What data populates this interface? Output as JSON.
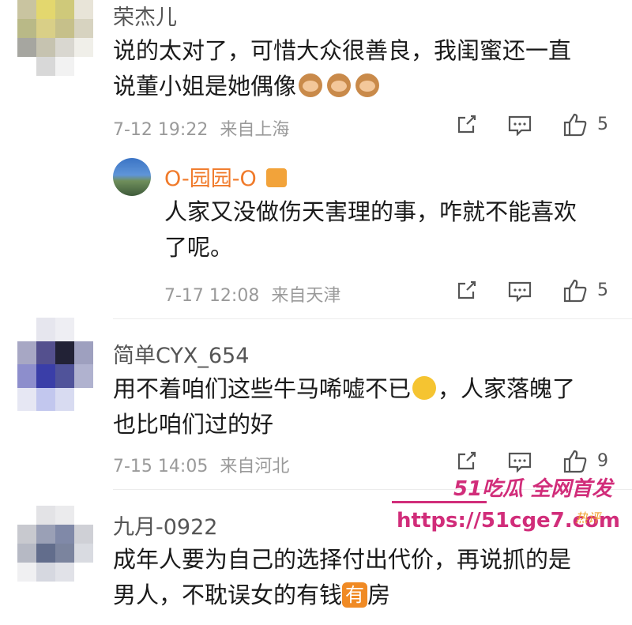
{
  "comments": [
    {
      "username": "荣杰儿",
      "text_lines": [
        "说的太对了，可惜大众很善良，我闺蜜还一直",
        "说董小姐是她偶像"
      ],
      "emoji": [
        "monkey-see-no-evil-icon",
        "monkey-see-no-evil-icon",
        "monkey-see-no-evil-icon"
      ],
      "timestamp": "7-12 19:22",
      "location": "来自上海",
      "likes": "5",
      "reply": {
        "username": "O-园园-O",
        "username_color": "#f07a2a",
        "text_lines": [
          "人家又没做伤天害理的事，咋就不能喜欢",
          "了呢。"
        ],
        "timestamp": "7-17 12:08",
        "location": "来自天津",
        "likes": "5"
      }
    },
    {
      "username": "简单CYX_654",
      "text_lines_1": "用不着咱们这些牛马唏嘘不已",
      "text_lines_1b": "，人家落魄了",
      "text_lines_2": "也比咱们过的好",
      "timestamp": "7-15 14:05",
      "location": "来自河北",
      "likes": "9"
    },
    {
      "username": "九月-0922",
      "text_lines_1": "成年人要为自己的选择付出代价，再说抓的是",
      "text_lines_2a": "男人，不耽误女的有钱",
      "badge": "有",
      "text_lines_2b": "房"
    }
  ],
  "watermark": {
    "title": "51吃瓜 全网首发",
    "url": "https://51cge7.com",
    "tag": "热评",
    "color": "#d12d7a"
  }
}
